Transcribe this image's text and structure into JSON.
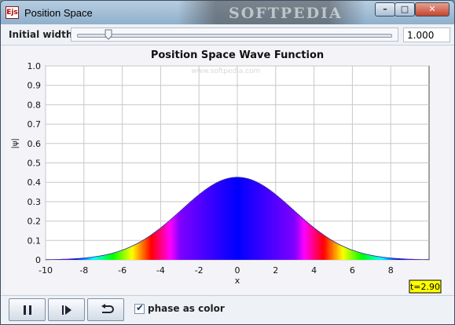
{
  "window": {
    "title": "Position Space",
    "app_icon_text": "Ejs",
    "watermark": "SOFTPEDIA",
    "controls": {
      "minimize": "–",
      "maximize": "□",
      "close": "✕"
    }
  },
  "toolbar": {
    "label": "Initial width =",
    "slider_value": "1.000",
    "slider_fraction": 0.1
  },
  "chart_data": {
    "type": "area",
    "title": "Position Space Wave Function",
    "xlabel": "x",
    "ylabel": "|ψ|",
    "xlim": [
      -10,
      10
    ],
    "ylim": [
      0,
      1
    ],
    "x_tick_labels": [
      "-10",
      "-8",
      "-6",
      "-4",
      "-2",
      "0",
      "2",
      "4",
      "6",
      "8"
    ],
    "y_tick_labels": [
      "0",
      "0.1",
      "0.2",
      "0.3",
      "0.4",
      "0.5",
      "0.6",
      "0.7",
      "0.8",
      "0.9",
      "1.0"
    ],
    "watermark": "www.softpedia.com",
    "grid": true,
    "fill": "phase as color",
    "x": [
      -10,
      -9,
      -8,
      -7,
      -6,
      -5,
      -4,
      -3,
      -2,
      -1,
      0,
      1,
      2,
      3,
      4,
      5,
      6,
      7,
      8,
      9,
      10
    ],
    "y": [
      0.005,
      0.011,
      0.022,
      0.04,
      0.066,
      0.1,
      0.143,
      0.19,
      0.24,
      0.4,
      0.426,
      0.4,
      0.24,
      0.19,
      0.143,
      0.1,
      0.066,
      0.04,
      0.022,
      0.011,
      0.005
    ],
    "time_label": "t=2.90"
  },
  "bottom": {
    "buttons": [
      {
        "name": "pause-button",
        "icon": "pause-icon"
      },
      {
        "name": "step-button",
        "icon": "step-forward-icon"
      },
      {
        "name": "reset-button",
        "icon": "reset-icon"
      }
    ],
    "checkbox_label": "phase as color",
    "checkbox_checked": true
  }
}
